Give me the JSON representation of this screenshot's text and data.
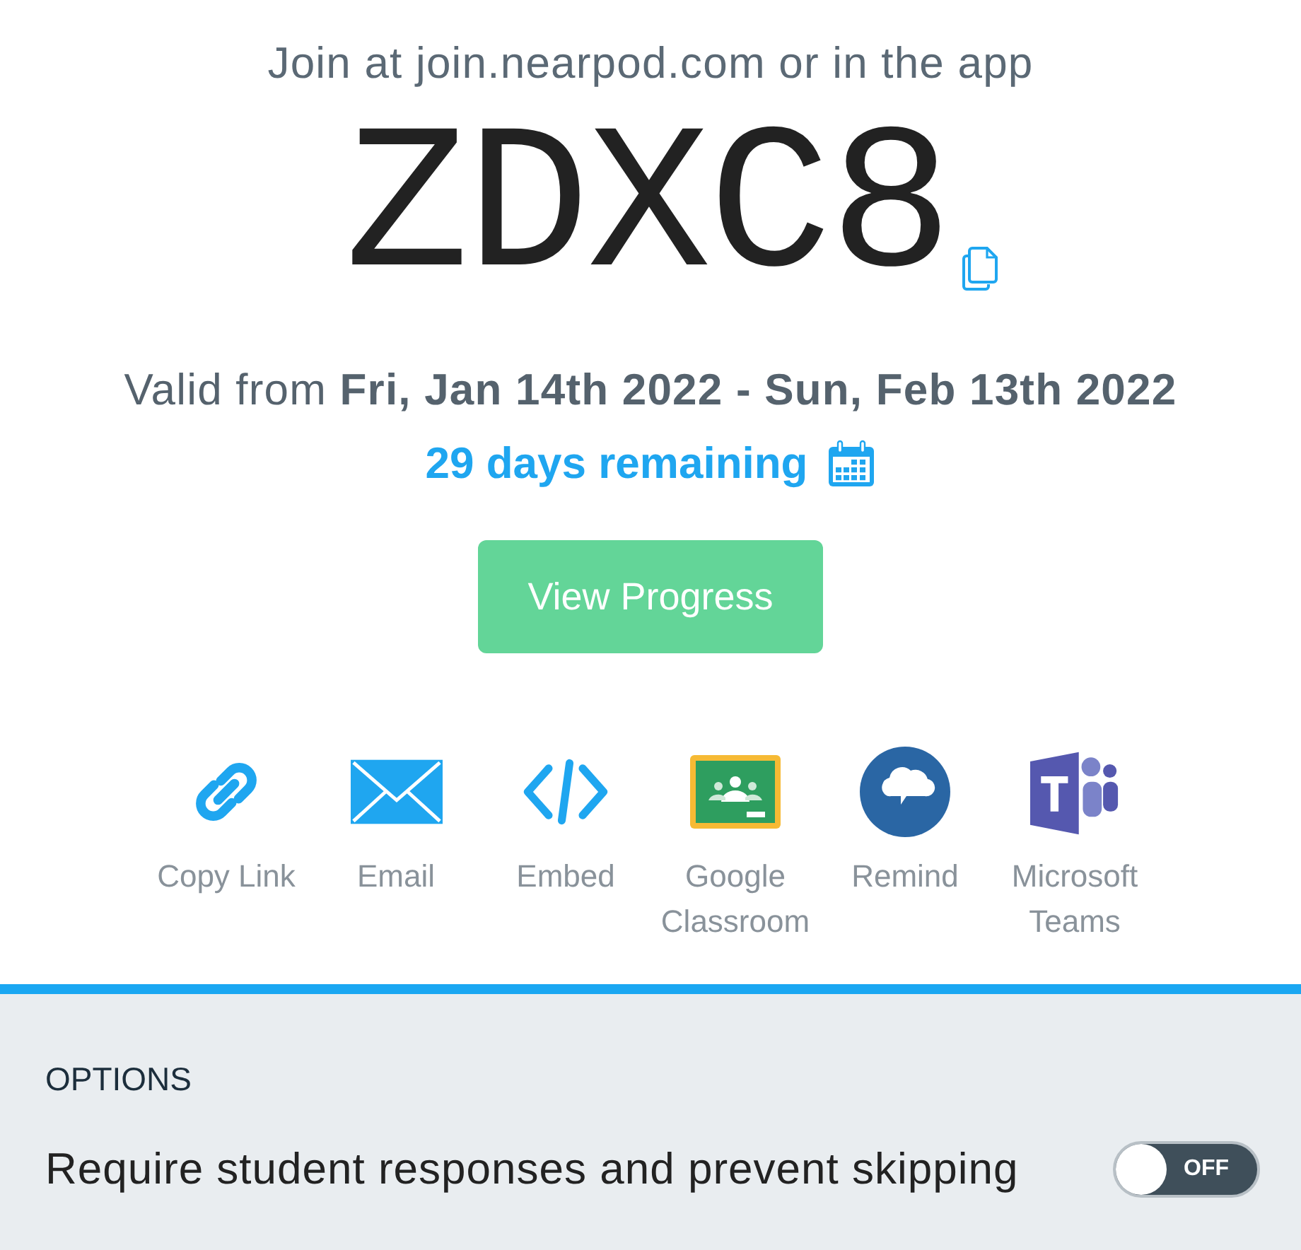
{
  "join_hint": "Join at join.nearpod.com or in the app",
  "code": "ZDXC8",
  "validity": "Valid from **Fri, Jan 14th 2022 - Sun, Feb 13th 2022**",
  "remaining": "29 days remaining",
  "primary_button": "View Progress",
  "share_options": [
    {
      "kind": "link",
      "label": "Copy Link"
    },
    {
      "kind": "email",
      "label": "Email"
    },
    {
      "kind": "embed",
      "label": "Embed"
    },
    {
      "kind": "classroom",
      "label": "Google Classroom"
    },
    {
      "kind": "remind",
      "label": "Remind"
    },
    {
      "kind": "teams",
      "label": "Microsoft Teams"
    }
  ],
  "options": {
    "heading": "OPTIONS",
    "items": [
      {
        "label": "Require student responses and prevent skipping",
        "on": false,
        "toggle_text": "OFF"
      }
    ]
  }
}
